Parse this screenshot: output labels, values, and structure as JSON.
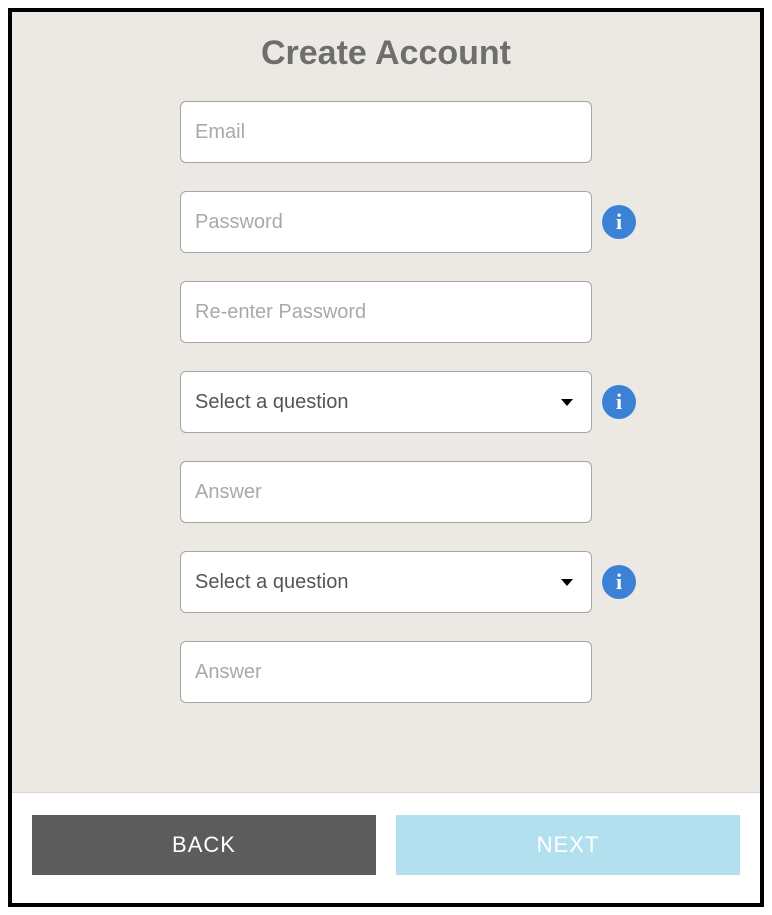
{
  "title": "Create Account",
  "fields": {
    "email": {
      "placeholder": "Email",
      "value": ""
    },
    "password": {
      "placeholder": "Password",
      "value": ""
    },
    "reenter_password": {
      "placeholder": "Re-enter Password",
      "value": ""
    },
    "question1": {
      "selected": "Select a question"
    },
    "answer1": {
      "placeholder": "Answer",
      "value": ""
    },
    "question2": {
      "selected": "Select a question"
    },
    "answer2": {
      "placeholder": "Answer",
      "value": ""
    }
  },
  "buttons": {
    "back": "BACK",
    "next": "NEXT"
  },
  "colors": {
    "info_icon": "#3b82d6",
    "back_button": "#5c5c5c",
    "next_button": "#b3e0ef",
    "form_bg": "#ece9e4"
  }
}
